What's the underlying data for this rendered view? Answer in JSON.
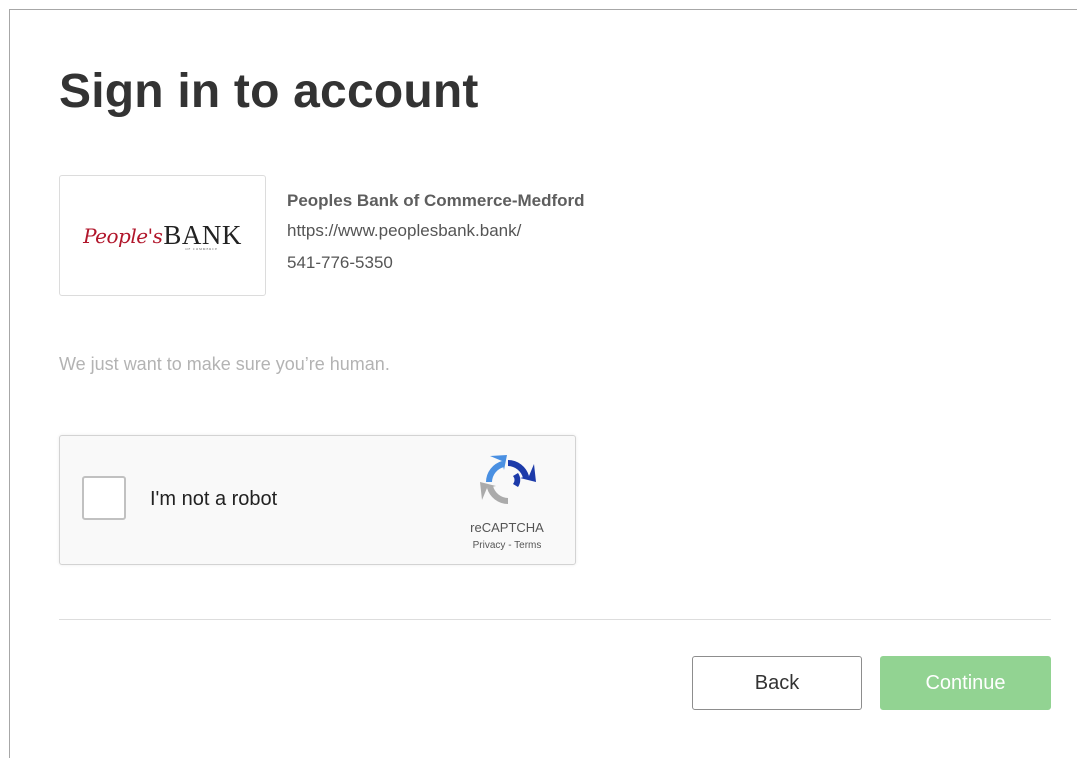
{
  "page": {
    "title": "Sign in to account"
  },
  "institution": {
    "logo_script": "People's",
    "logo_bank": "BANK",
    "logo_sub": "OF COMMERCE",
    "name": "Peoples Bank of Commerce-Medford",
    "url": "https://www.peoplesbank.bank/",
    "phone": "541-776-5350"
  },
  "verification": {
    "message": "We just want to make sure you’re human."
  },
  "recaptcha": {
    "label": "I'm not a robot",
    "brand": "reCAPTCHA",
    "privacy": "Privacy",
    "separator": " - ",
    "terms": "Terms",
    "checked": false
  },
  "actions": {
    "back_label": "Back",
    "continue_label": "Continue"
  },
  "colors": {
    "continue_disabled": "#92d392",
    "title": "#333333",
    "logo_red": "#b1162b"
  }
}
